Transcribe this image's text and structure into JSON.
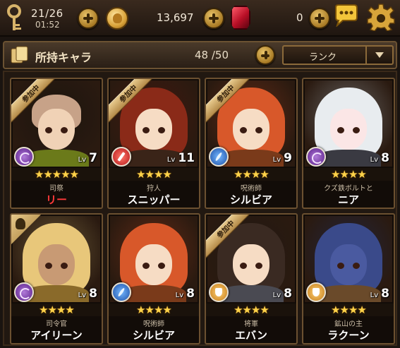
{
  "status_bar": {
    "stamina": "21/26",
    "timer": "01:52",
    "gold": "13,697",
    "gems": "0"
  },
  "header": {
    "title": "所持キャラ",
    "count": "48 /50",
    "sort_label": "ランク"
  },
  "characters": [
    {
      "role": "司祭",
      "name": "リー",
      "level": "7",
      "stars": "★★★★★",
      "badge": "参加中",
      "class": "purple",
      "name_color": "#ff3a3a"
    },
    {
      "role": "狩人",
      "name": "スニッパー",
      "level": "11",
      "stars": "★★★★",
      "badge": "参加中",
      "class": "red"
    },
    {
      "role": "呪術師",
      "name": "シルビア",
      "level": "9",
      "stars": "★★★★",
      "badge": "参加中",
      "class": "blue"
    },
    {
      "role": "クズ鉄ボルトと",
      "name": "ニア",
      "level": "8",
      "stars": "★★★★",
      "badge": "",
      "class": "purple"
    },
    {
      "role": "司令官",
      "name": "アイリーン",
      "level": "8",
      "stars": "★★★★",
      "badge": "leader",
      "class": "purple"
    },
    {
      "role": "呪術師",
      "name": "シルビア",
      "level": "8",
      "stars": "★★★★",
      "badge": "",
      "class": "blue"
    },
    {
      "role": "将軍",
      "name": "エバン",
      "level": "8",
      "stars": "★★★★",
      "badge": "参加中",
      "class": "gold"
    },
    {
      "role": "鉱山の主",
      "name": "ラクーン",
      "level": "8",
      "stars": "★★★★",
      "badge": "",
      "class": "gold"
    }
  ],
  "lv_prefix": "Lv"
}
